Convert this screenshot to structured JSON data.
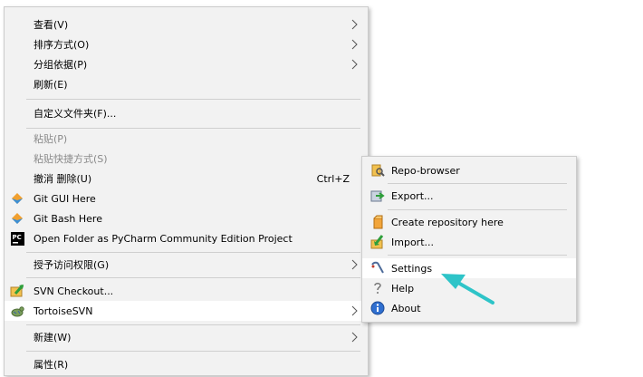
{
  "main_menu": {
    "view": "查看(V)",
    "sort_by": "排序方式(O)",
    "group_by": "分组依据(P)",
    "refresh": "刷新(E)",
    "customize_folder": "自定义文件夹(F)...",
    "paste": "粘贴(P)",
    "paste_shortcut": "粘贴快捷方式(S)",
    "undo_delete": "撤消 删除(U)",
    "undo_shortcut": "Ctrl+Z",
    "git_gui": "Git GUI Here",
    "git_bash": "Git Bash Here",
    "pycharm": "Open Folder as PyCharm Community Edition Project",
    "give_access": "授予访问权限(G)",
    "svn_checkout": "SVN Checkout...",
    "tortoise_svn": "TortoiseSVN",
    "new": "新建(W)",
    "properties": "属性(R)"
  },
  "sub_menu": {
    "repo_browser": "Repo-browser",
    "export": "Export...",
    "create_repo": "Create repository here",
    "import": "Import...",
    "settings": "Settings",
    "help": "Help",
    "about": "About"
  },
  "icons": {
    "pycharm_badge": "PC"
  },
  "colors": {
    "menu_bg": "#f2f2f2",
    "hover_bg": "#ffffff",
    "annotation_arrow": "#2ec4c8"
  }
}
